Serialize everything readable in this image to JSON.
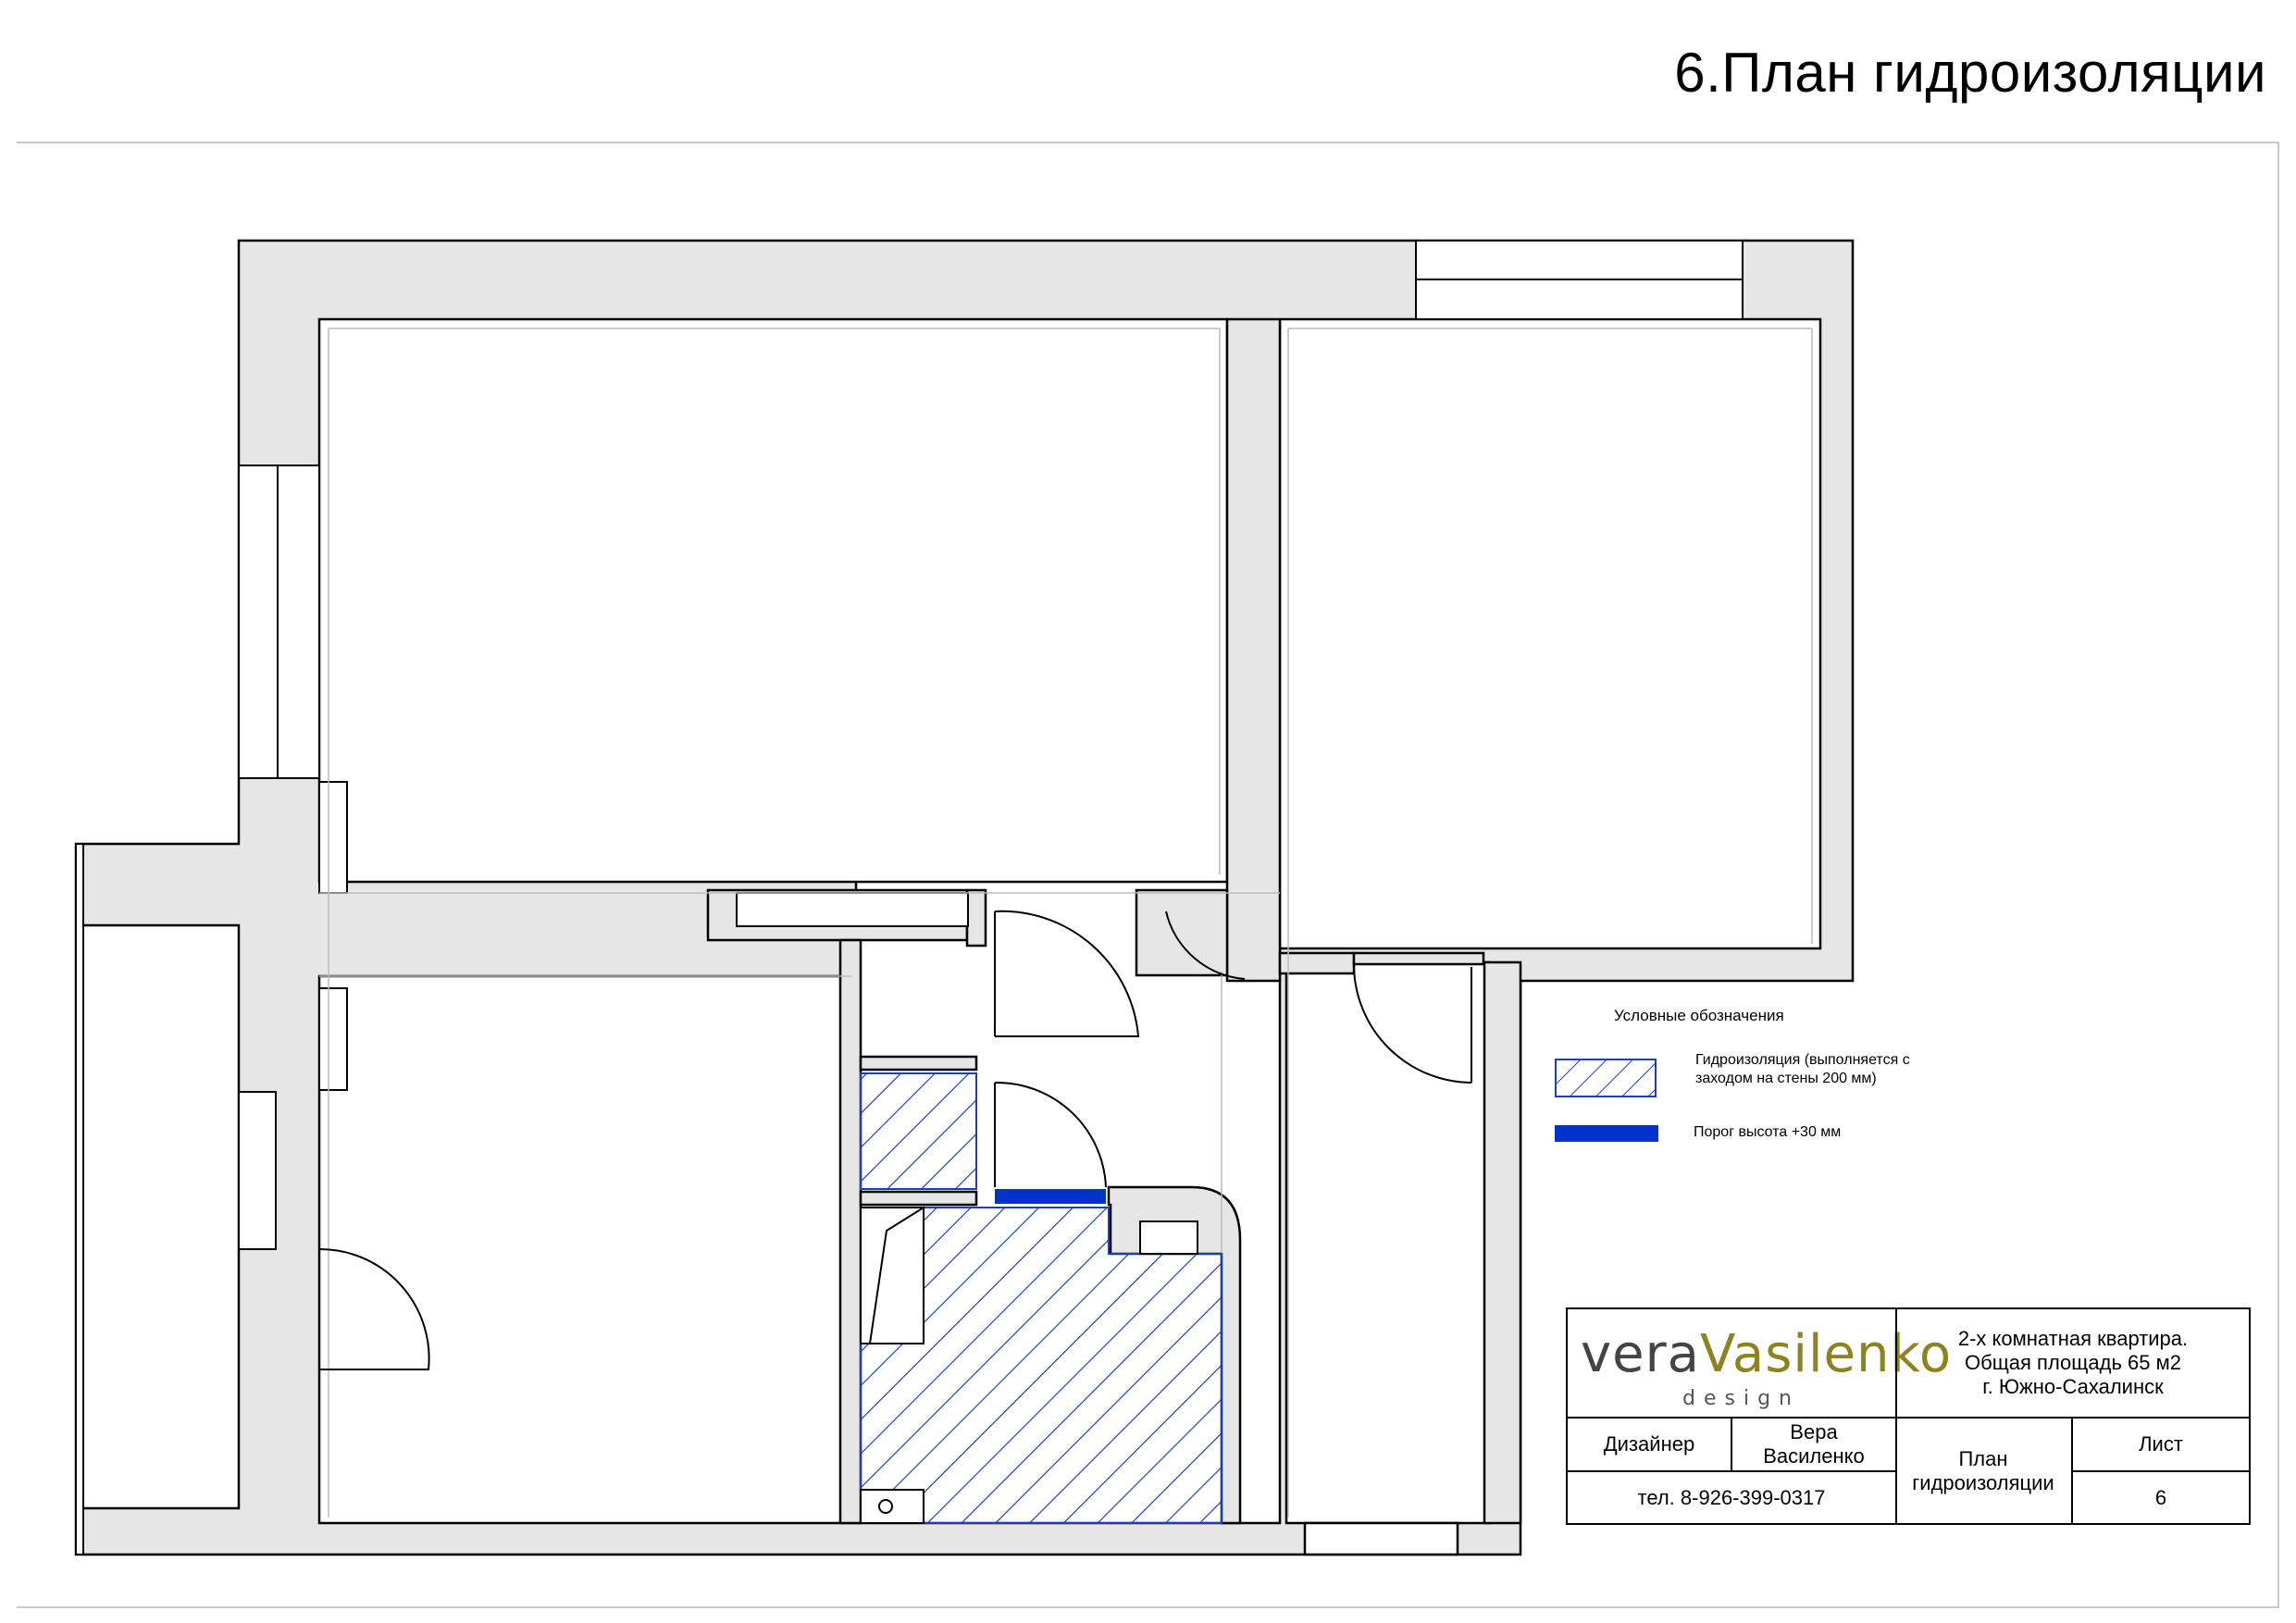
{
  "sheet": {
    "title": "6.План гидроизоляции"
  },
  "legend": {
    "title": "Условные обозначения",
    "waterproofing_label": "Гидроизоляция (выполняется с заходом на стены 200 мм)",
    "threshold_label": "Порог высота +30 мм",
    "colors": {
      "hatch": "#1c3fb8",
      "threshold": "#0033cc",
      "wall_fill": "#e6e6e6"
    }
  },
  "stamp": {
    "logo_part1": "vera",
    "logo_part2": "Vasilenko",
    "logo_sub": "design",
    "project_line1": "2-х комнатная квартира.",
    "project_line2": "Общая площадь 65 м2",
    "project_line3": "г. Южно-Сахалинск",
    "designer_label": "Дизайнер",
    "designer_name": "Вера Василенко",
    "phone": "тел. 8-926-399-0317",
    "drawing_name": "План гидроизоляции",
    "sheet_label": "Лист",
    "sheet_number": "6"
  }
}
